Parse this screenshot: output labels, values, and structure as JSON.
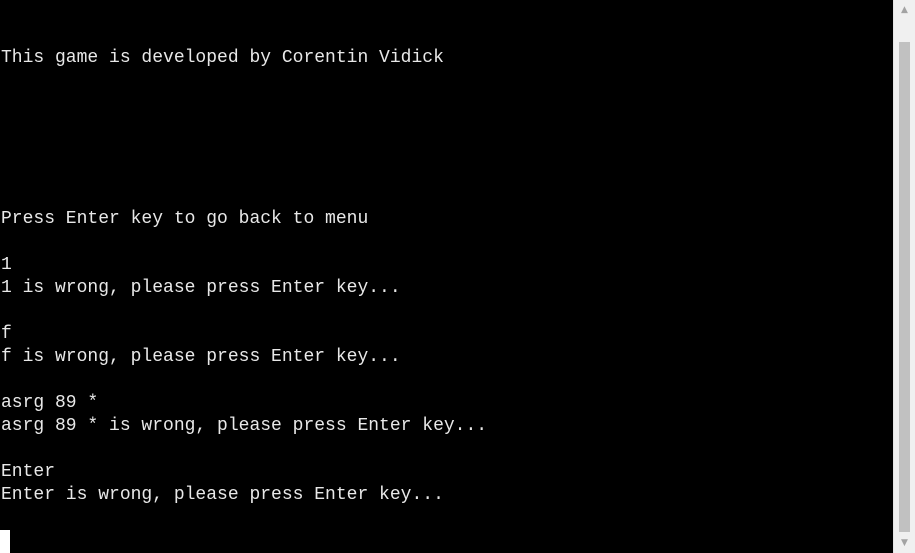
{
  "terminal": {
    "lines": [
      "This game is developed by Corentin Vidick",
      "Press Enter key to go back to menu",
      "1",
      "1 is wrong, please press Enter key...",
      "f",
      "f is wrong, please press Enter key...",
      "asrg 89 *",
      "asrg 89 * is wrong, please press Enter key...",
      "Enter",
      "Enter is wrong, please press Enter key..."
    ],
    "colors": {
      "background": "#000000",
      "text": "#e8e8e8",
      "cursor": "#ffffff"
    }
  },
  "scrollbar": {
    "up_icon": "triangle-up-icon",
    "down_icon": "triangle-down-icon"
  }
}
